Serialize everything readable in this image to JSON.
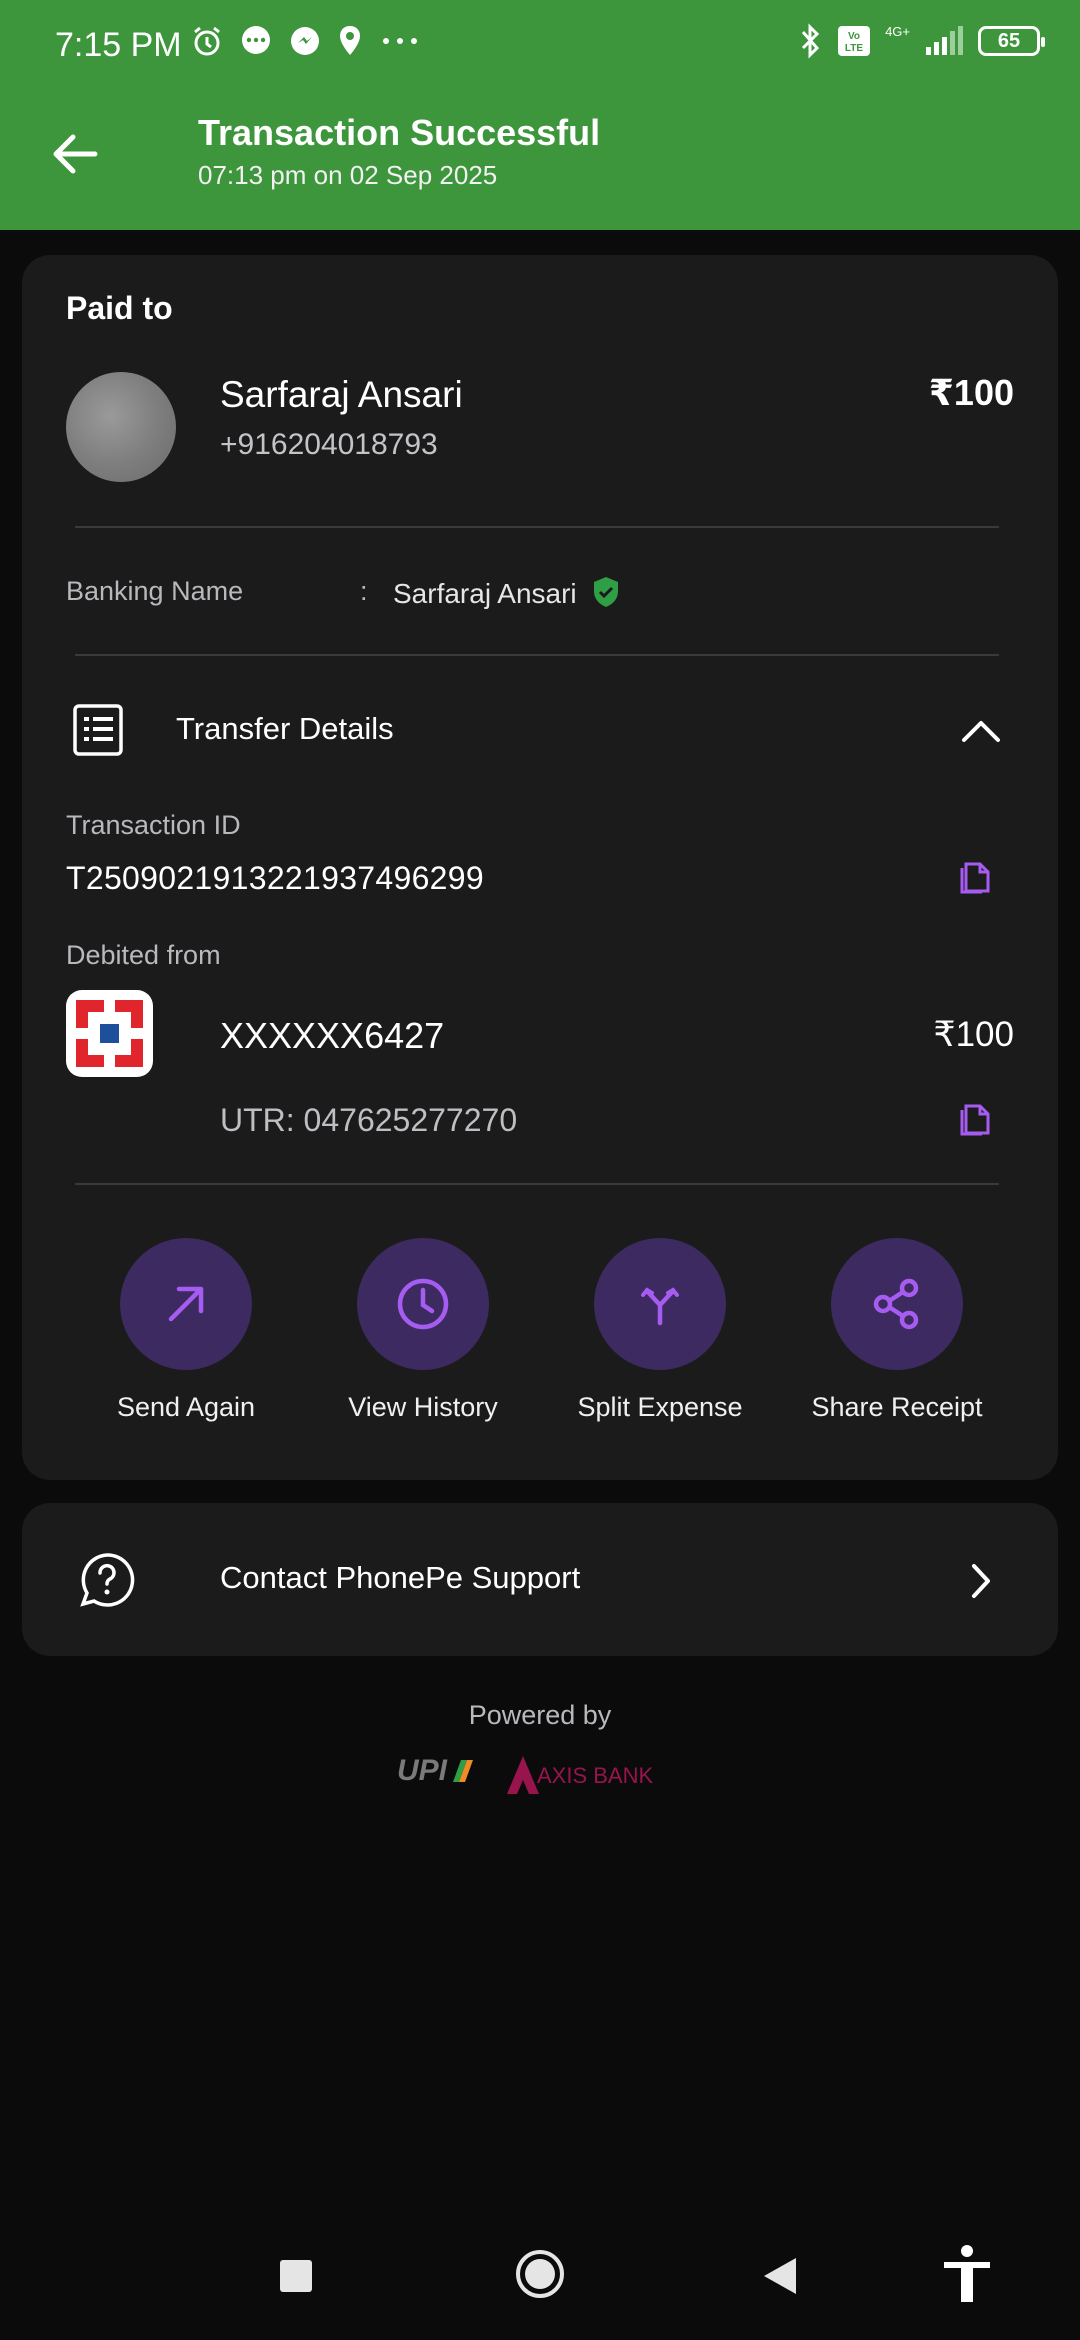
{
  "status_bar": {
    "time": "7:15 PM",
    "battery": "65",
    "network": "4G+"
  },
  "header": {
    "title": "Transaction Successful",
    "subtitle": "07:13 pm on 02 Sep 2025",
    "back_icon": "arrow-left-icon"
  },
  "payee": {
    "section_label": "Paid to",
    "name": "Sarfaraj Ansari",
    "phone": "+916204018793",
    "amount": "₹100"
  },
  "banking": {
    "label": "Banking Name",
    "colon": ":",
    "value": "Sarfaraj Ansari"
  },
  "transfer": {
    "title": "Transfer Details",
    "txn_label": "Transaction ID",
    "txn_id": "T2509021913221937496299",
    "debited_label": "Debited from",
    "account": "XXXXXX6427",
    "amount": "₹100",
    "utr": "UTR: 047625277270"
  },
  "actions": [
    {
      "label": "Send Again",
      "icon": "arrow-up-right-icon"
    },
    {
      "label": "View History",
      "icon": "clock-icon"
    },
    {
      "label": "Split Expense",
      "icon": "split-icon"
    },
    {
      "label": "Share Receipt",
      "icon": "share-icon"
    }
  ],
  "support": {
    "label": "Contact PhonePe Support"
  },
  "footer": {
    "powered_by": "Powered by",
    "upi_logo_text": "UPI",
    "bank_logo_text": "AXIS BANK"
  },
  "colors": {
    "header_green": "#3d963c",
    "accent_purple": "#a65cf0",
    "action_bg": "#3d2a60",
    "verified_green": "#2f9e44"
  }
}
